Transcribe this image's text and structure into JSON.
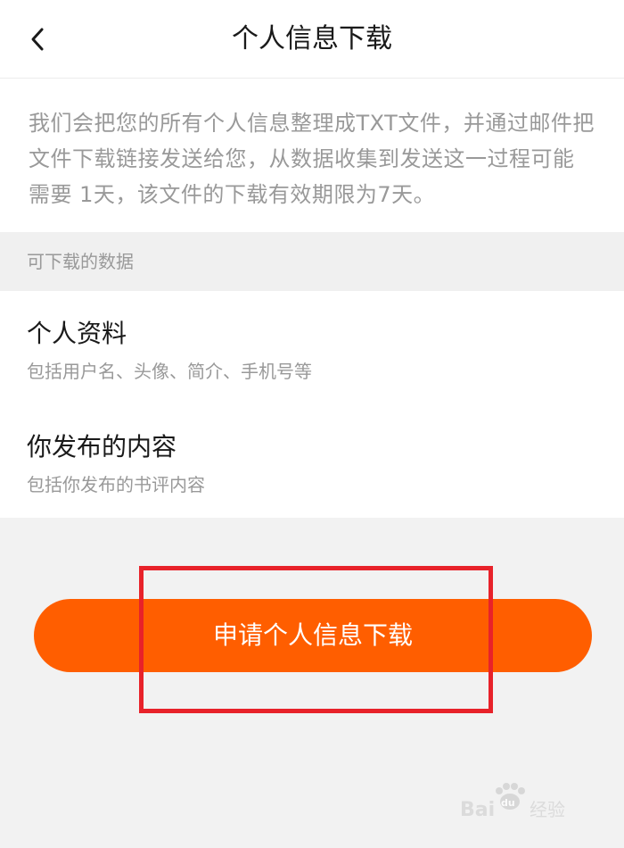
{
  "header": {
    "title": "个人信息下载",
    "back_icon": "chevron-left-icon"
  },
  "intro": {
    "text": "我们会把您的所有个人信息整理成TXT文件，并通过邮件把文件下载链接发送给您，从数据收集到发送这一过程可能需要 1天，该文件的下载有效期限为7天。"
  },
  "section": {
    "label": "可下载的数据"
  },
  "items": [
    {
      "title": "个人资料",
      "desc": "包括用户名、头像、简介、手机号等"
    },
    {
      "title": "你发布的内容",
      "desc": "包括你发布的书评内容"
    }
  ],
  "action": {
    "label": "申请个人信息下载"
  },
  "watermark": {
    "text": "Bai du 经验"
  },
  "colors": {
    "accent": "#ff5e00",
    "highlight": "#e8222a",
    "background": "#f2f2f2",
    "secondary_text": "#999999"
  }
}
